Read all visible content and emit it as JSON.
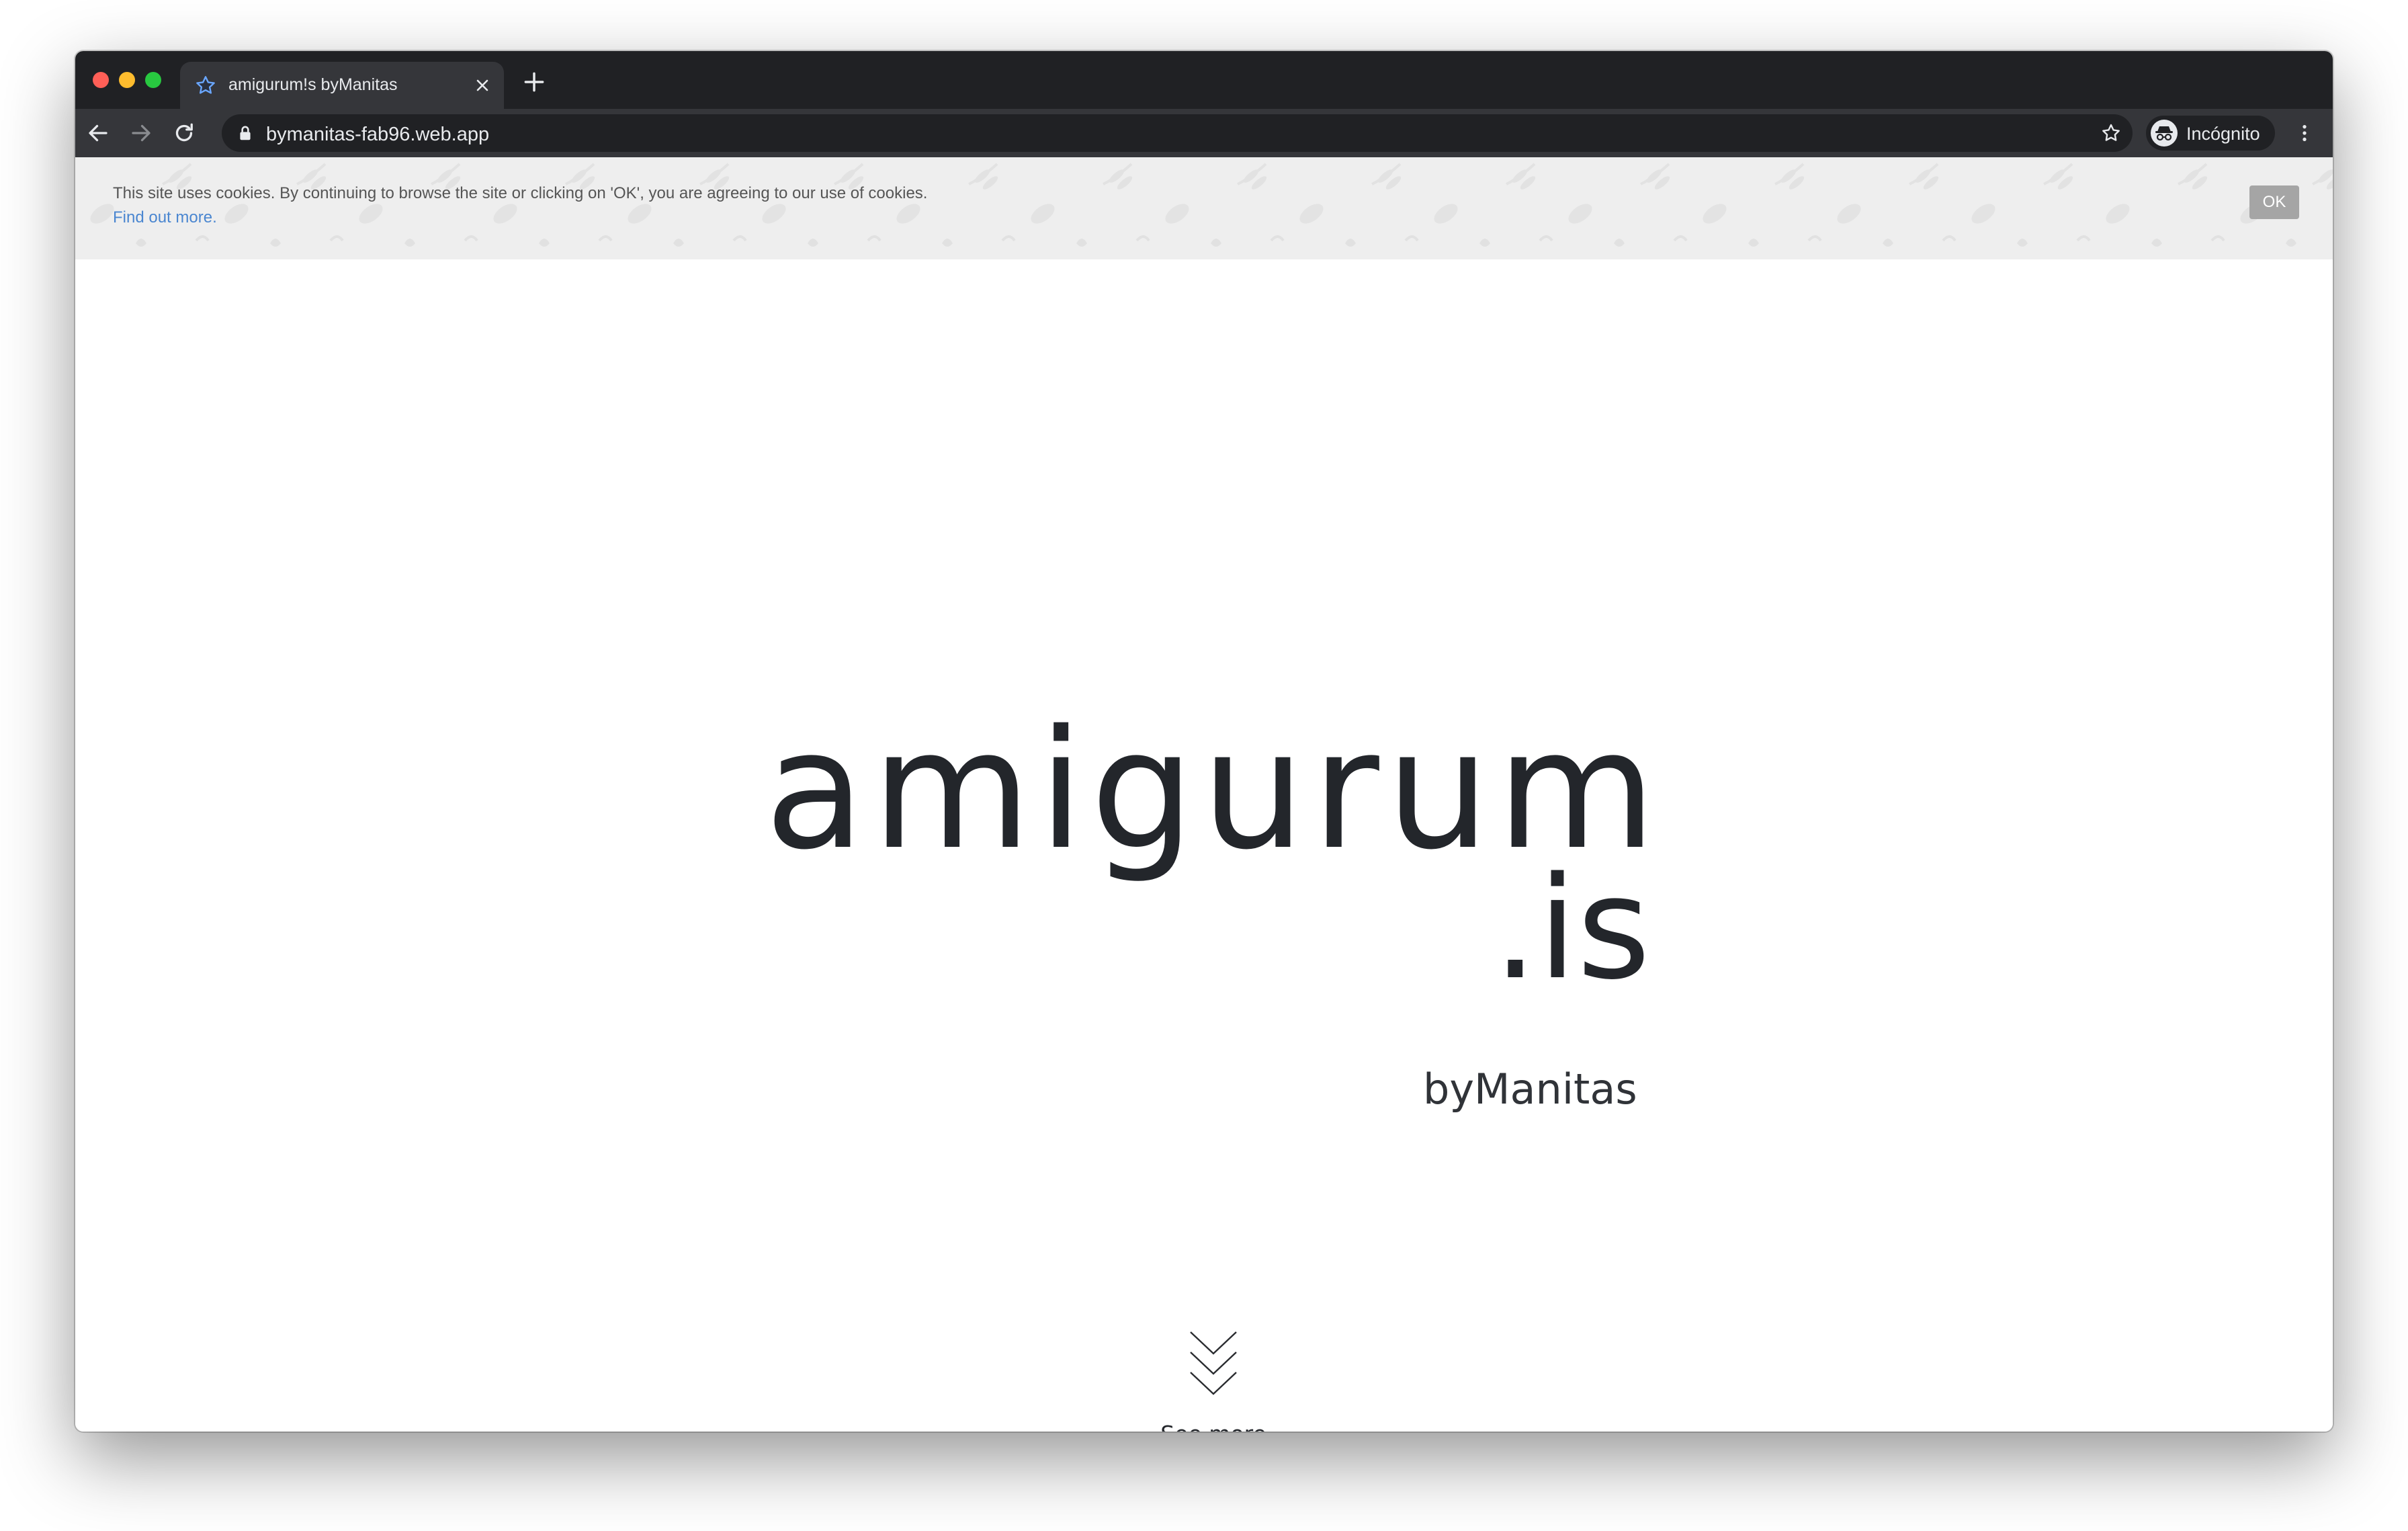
{
  "browser": {
    "tab": {
      "title": "amigurum!s byManitas",
      "favicon": "star-icon"
    },
    "address_bar": {
      "url": "bymanitas-fab96.web.app"
    },
    "profile": {
      "label": "Incógnito",
      "icon": "incognito-icon"
    },
    "colors": {
      "frame": "#202124",
      "toolbar": "#35363a",
      "text": "#e8eaed"
    }
  },
  "cookie_banner": {
    "message": "This site uses cookies. By continuing to browse the site or clicking on 'OK', you are agreeing to our use of cookies.",
    "link_text": "Find out more.",
    "ok_label": "OK",
    "colors": {
      "background": "#eeeeee",
      "link": "#4a86d0",
      "button": "#a5a5a5"
    }
  },
  "hero": {
    "logo_main": "amigurum",
    "logo_suffix": ".is",
    "logo_by": "byManitas",
    "see_more_label": "See more",
    "text_color": "#23262b"
  }
}
